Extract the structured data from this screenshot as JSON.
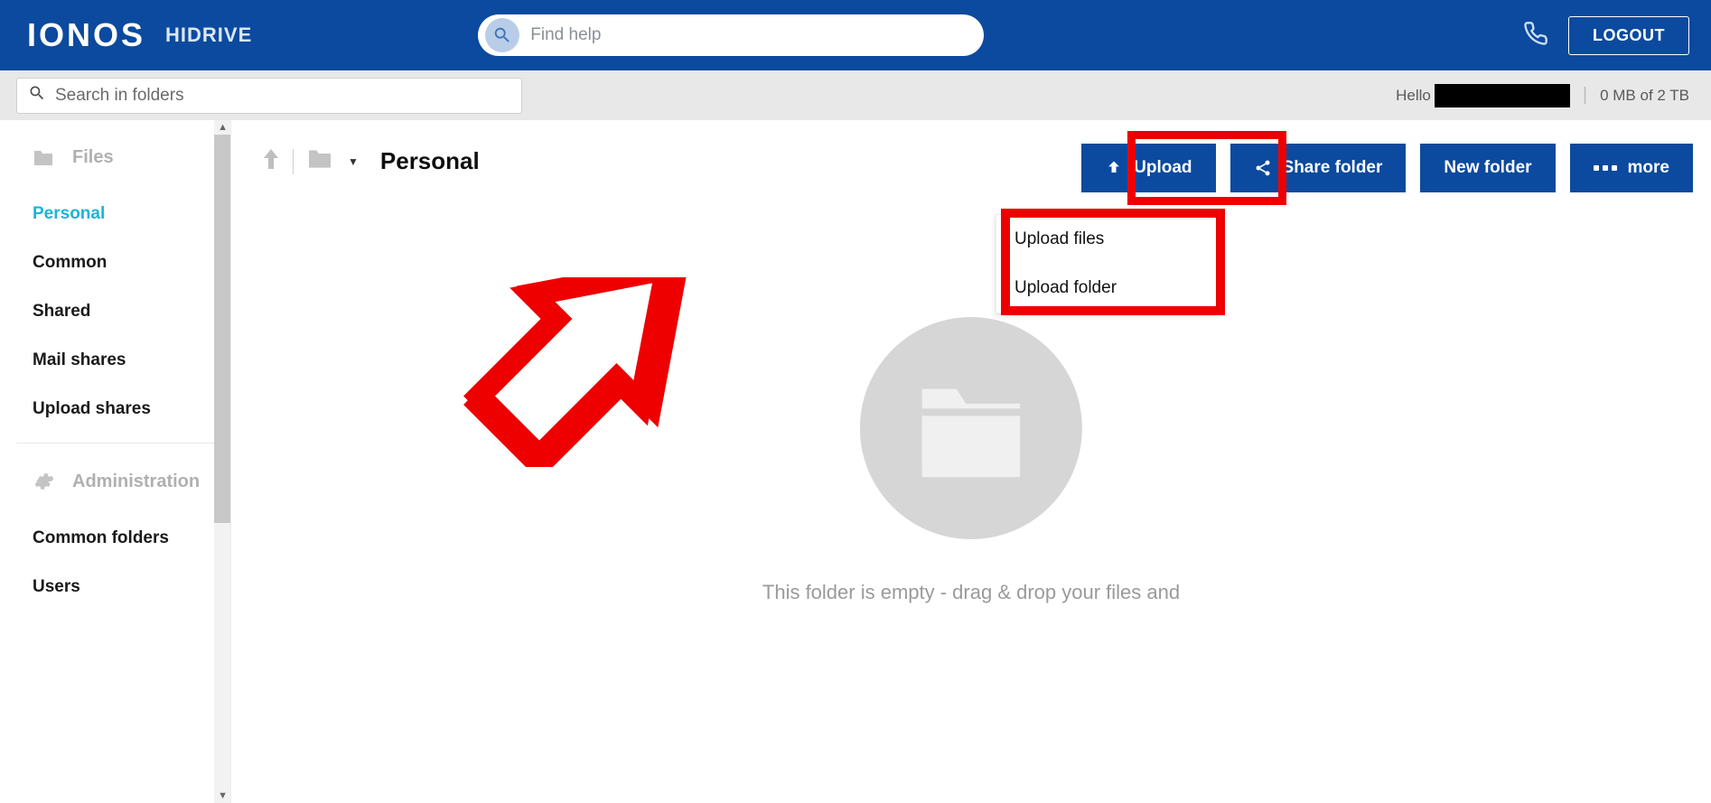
{
  "header": {
    "brand": "IONOS",
    "product": "HIDRIVE",
    "help_placeholder": "Find help",
    "logout_label": "LOGOUT"
  },
  "subheader": {
    "search_placeholder": "Search in folders",
    "greeting": "Hello",
    "storage": "0 MB of 2 TB"
  },
  "sidebar": {
    "files_head": "Files",
    "items": [
      {
        "label": "Personal",
        "active": true
      },
      {
        "label": "Common",
        "active": false
      },
      {
        "label": "Shared",
        "active": false
      },
      {
        "label": "Mail shares",
        "active": false
      },
      {
        "label": "Upload shares",
        "active": false
      }
    ],
    "admin_head": "Administration",
    "admin_items": [
      {
        "label": "Common folders"
      },
      {
        "label": "Users"
      }
    ]
  },
  "breadcrumb": {
    "title": "Personal"
  },
  "toolbar": {
    "upload_label": "Upload",
    "share_label": "Share folder",
    "newfolder_label": "New folder",
    "more_label": "more"
  },
  "dropdown": {
    "upload_files": "Upload files",
    "upload_folder": "Upload folder"
  },
  "empty_state": {
    "text": "This folder is empty - drag & drop your files and"
  }
}
